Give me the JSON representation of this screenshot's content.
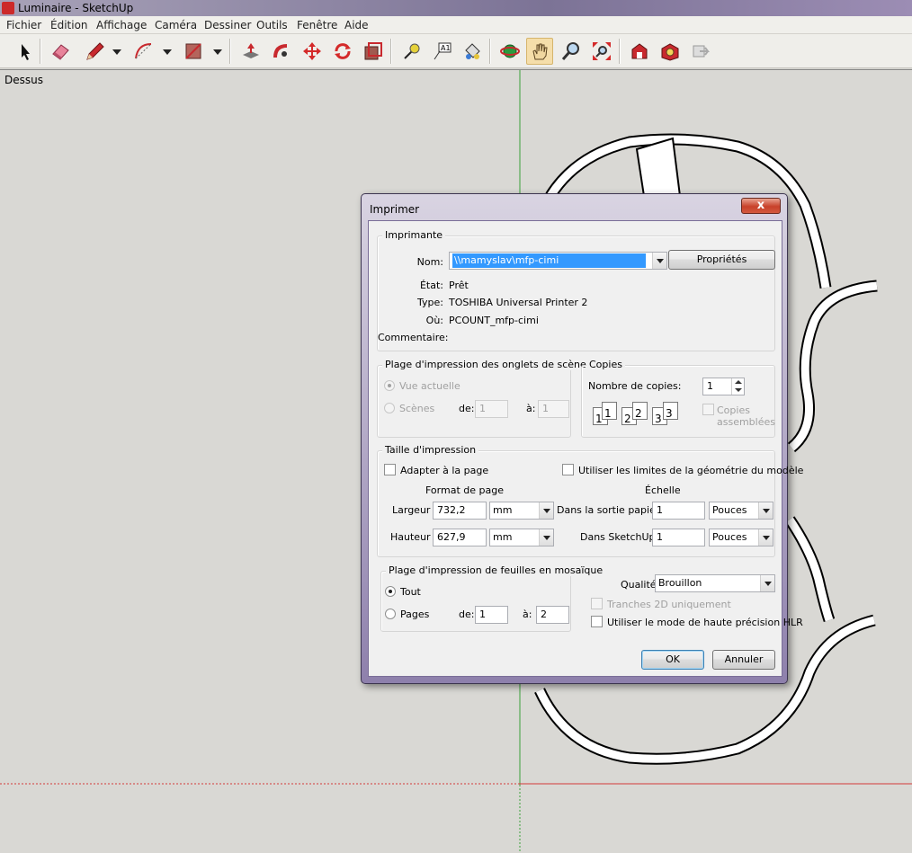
{
  "window": {
    "title": "Luminaire - SketchUp"
  },
  "menu": [
    "Fichier",
    "Édition",
    "Affichage",
    "Caméra",
    "Dessiner",
    "Outils",
    "Fenêtre",
    "Aide"
  ],
  "toolbar": {
    "icons": [
      "select-icon",
      "eraser-icon",
      "pencil-icon",
      "arc-icon",
      "rectangle-icon",
      "push-pull-icon",
      "follow-me-icon",
      "move-icon",
      "rotate-icon",
      "offset-icon",
      "tape-measure-icon",
      "text-icon",
      "paint-bucket-icon",
      "orbit-icon",
      "pan-icon",
      "zoom-icon",
      "zoom-extents-icon",
      "warehouse-icon",
      "components-icon",
      "share-icon"
    ],
    "active": "pan-icon"
  },
  "viewport": {
    "view_name": "Dessus",
    "axis_colors": {
      "green": "#3aa03a",
      "red": "#d43a3a"
    }
  },
  "dialog": {
    "title": "Imprimer",
    "close_symbol": "x",
    "printer": {
      "group_title": "Imprimante",
      "name_label": "Nom:",
      "name_value": "\\\\mamyslav\\mfp-cimi",
      "properties_button": "Propriétés",
      "state_label": "État:",
      "state_value": "Prêt",
      "type_label": "Type:",
      "type_value": "TOSHIBA Universal Printer 2",
      "where_label": "Où:",
      "where_value": "PCOUNT_mfp-cimi",
      "comment_label": "Commentaire:"
    },
    "scene_range": {
      "group_title": "Plage d'impression des onglets de scène",
      "current_view": "Vue actuelle",
      "scenes": "Scènes",
      "from_label": "de:",
      "from_value": "1",
      "to_label": "à:",
      "to_value": "1"
    },
    "copies": {
      "group_title": "Copies",
      "count_label": "Nombre de copies:",
      "count_value": "1",
      "collate_label_1": "Copies",
      "collate_label_2": "assemblées",
      "page_digits": [
        "1",
        "1",
        "2",
        "2",
        "3",
        "3"
      ]
    },
    "print_size": {
      "group_title": "Taille d'impression",
      "fit_page": "Adapter à la page",
      "use_model_extents": "Utiliser les limites de la géométrie du modèle",
      "page_format_heading": "Format de page",
      "scale_heading": "Échelle",
      "width_label": "Largeur",
      "width_value": "732,2",
      "width_unit": "mm",
      "height_label": "Hauteur",
      "height_value": "627,9",
      "height_unit": "mm",
      "paper_output_label": "Dans la sortie papier",
      "paper_output_value": "1",
      "paper_output_unit": "Pouces",
      "in_sketchup_label": "Dans SketchUp",
      "in_sketchup_value": "1",
      "in_sketchup_unit": "Pouces"
    },
    "tile_range": {
      "group_title": "Plage d'impression de feuilles en mosaïque",
      "all": "Tout",
      "pages": "Pages",
      "from_label": "de:",
      "from_value": "1",
      "to_label": "à:",
      "to_value": "2"
    },
    "quality": {
      "label": "Qualité",
      "value": "Brouillon",
      "slices_2d": "Tranches 2D uniquement",
      "hlr_mode": "Utiliser le mode de haute précision HLR"
    },
    "ok_button": "OK",
    "cancel_button": "Annuler"
  }
}
